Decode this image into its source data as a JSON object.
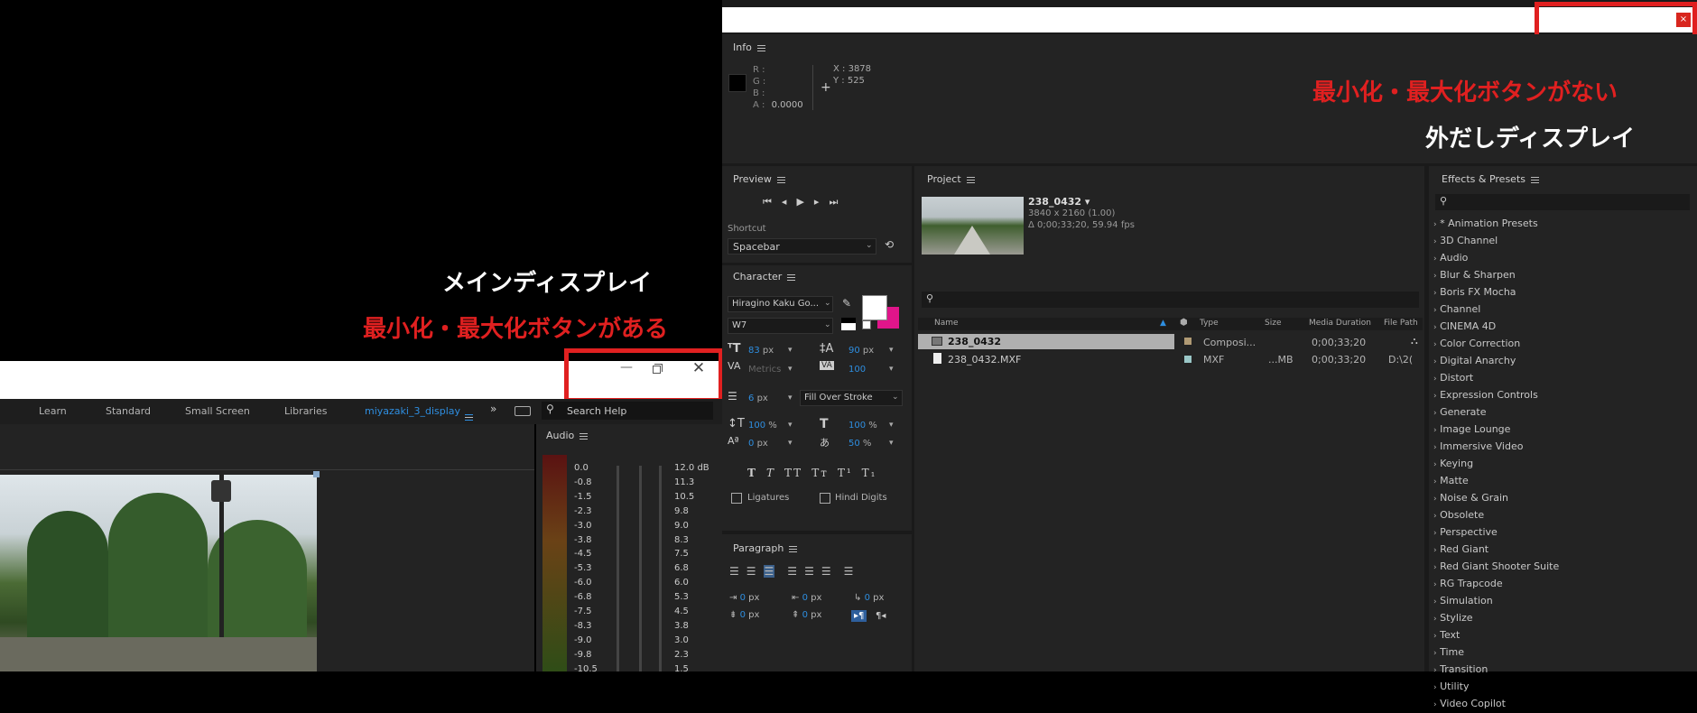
{
  "annotations": {
    "main_display": "メインディスプレイ",
    "main_note": "最小化・最大化ボタンがある",
    "external_display": "外だしディスプレイ",
    "external_note": "最小化・最大化ボタンがない"
  },
  "colors": {
    "annotation_red": "#e02020",
    "accent_blue": "#2e8ee0",
    "panel_bg": "#232323"
  },
  "left": {
    "workspaces": [
      "Learn",
      "Standard",
      "Small Screen",
      "Libraries",
      "miyazaki_3_display"
    ],
    "search_placeholder": "Search Help",
    "audio_title": "Audio",
    "audio_left": [
      "0.0",
      "-0.8",
      "-1.5",
      "-2.3",
      "-3.0",
      "-3.8",
      "-4.5",
      "-5.3",
      "-6.0",
      "-6.8",
      "-7.5",
      "-8.3",
      "-9.0",
      "-9.8",
      "-10.5"
    ],
    "audio_right": [
      "12.0 dB",
      "11.3",
      "10.5",
      "9.8",
      "9.0",
      "8.3",
      "7.5",
      "6.8",
      "6.0",
      "5.3",
      "4.5",
      "3.8",
      "3.0",
      "2.3",
      "1.5"
    ]
  },
  "info": {
    "title": "Info",
    "r": "R :",
    "g": "G :",
    "b": "B :",
    "a": "A :",
    "a_val": "0.0000",
    "x": "X : 3878",
    "y": "Y : 525"
  },
  "preview": {
    "title": "Preview",
    "shortcut_label": "Shortcut",
    "shortcut_value": "Spacebar"
  },
  "character": {
    "title": "Character",
    "font": "Hiragino Kaku Go...",
    "weight": "W7",
    "size": "83",
    "size_unit": "px",
    "leading": "90",
    "leading_unit": "px",
    "kerning": "Metrics",
    "tracking": "100",
    "stroke": "6",
    "stroke_unit": "px",
    "stroke_mode": "Fill Over Stroke",
    "vscale": "100",
    "vscale_unit": "%",
    "hscale": "100",
    "hscale_unit": "%",
    "baseline": "0",
    "baseline_unit": "px",
    "tsume": "50",
    "tsume_unit": "%",
    "ligatures": "Ligatures",
    "hindi": "Hindi Digits"
  },
  "paragraph": {
    "title": "Paragraph",
    "v1": "0",
    "v2": "0",
    "v3": "0",
    "v4": "0",
    "v5": "0",
    "unit": "px"
  },
  "project": {
    "title": "Project",
    "comp_name": "238_0432 ▾",
    "comp_dims": "3840 x 2160 (1.00)",
    "comp_dur": "Δ 0;00;33;20, 59.94 fps",
    "columns": [
      "Name",
      "Type",
      "Size",
      "Media Duration",
      "File Path"
    ],
    "rows": [
      {
        "name": "238_0432",
        "type": "Composi...",
        "size": "",
        "dur": "0;00;33;20",
        "path": ""
      },
      {
        "name": "238_0432.MXF",
        "type": "MXF",
        "size": "...MB",
        "dur": "0;00;33;20",
        "path": "D:\\2("
      }
    ]
  },
  "effects": {
    "title": "Effects & Presets",
    "items": [
      "* Animation Presets",
      "3D Channel",
      "Audio",
      "Blur & Sharpen",
      "Boris FX Mocha",
      "Channel",
      "CINEMA 4D",
      "Color Correction",
      "Digital Anarchy",
      "Distort",
      "Expression Controls",
      "Generate",
      "Image Lounge",
      "Immersive Video",
      "Keying",
      "Matte",
      "Noise & Grain",
      "Obsolete",
      "Perspective",
      "Red Giant",
      "Red Giant Shooter Suite",
      "RG Trapcode",
      "Simulation",
      "Stylize",
      "Text",
      "Time",
      "Transition",
      "Utility",
      "Video Copilot"
    ]
  }
}
